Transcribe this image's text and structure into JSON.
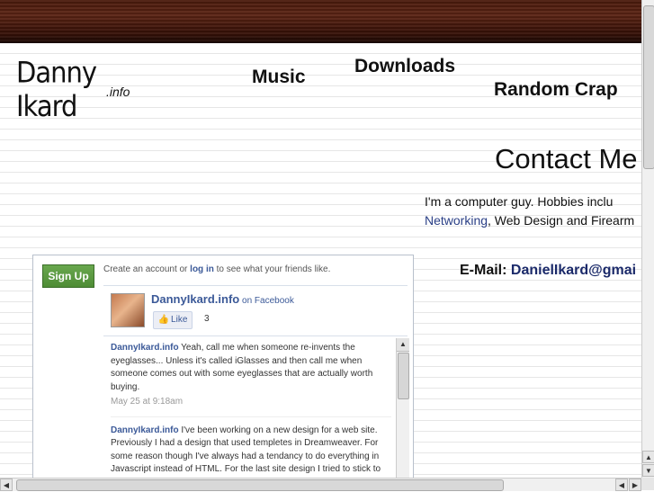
{
  "logo": {
    "main": "Danny Ikard",
    "sub": ".info"
  },
  "nav": {
    "music": "Music",
    "downloads": "Downloads",
    "random": "Random Crap"
  },
  "contact": {
    "title": "Contact Me",
    "intro_line1": "I'm a computer guy. Hobbies inclu",
    "intro_link": "Networking",
    "intro_line2_rest": ", Web Design and Firearm",
    "email_label": "E-Mail: ",
    "email_value": "DanielIkard@gmai"
  },
  "facebook": {
    "signup_label": "Sign Up",
    "create_prefix": "Create an account or ",
    "create_link": "log in",
    "create_suffix": " to see what your friends like.",
    "page_name": "DannyIkard.info",
    "on_facebook": " on Facebook",
    "like_label": "Like",
    "like_count": "3",
    "posts": [
      {
        "author": "DannyIkard.info",
        "text": " Yeah, call me when someone re-invents the eyeglasses... Unless it's called iGlasses and then call me when someone comes out with some eyeglasses that are actually worth buying.",
        "time": "May 25 at 9:18am"
      },
      {
        "author": "DannyIkard.info",
        "text": " I've been working on a new design for a web site. Previously I had a design that used templetes in Dreamweaver. For some reason though I've always had a tendancy to do everything in Javascript instead of HTML. For the last site design I tried to stick to",
        "time": ""
      }
    ]
  },
  "colors": {
    "wood": "#4a1a0c",
    "link": "#3b5998",
    "signup_green": "#5a9a3f"
  }
}
